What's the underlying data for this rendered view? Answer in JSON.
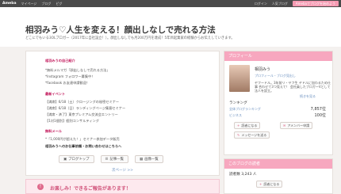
{
  "topbar": {
    "logo": "Ameba",
    "links": [
      "マイページ",
      "ブログ",
      "ピグ"
    ],
    "right_links": [
      "ログイン",
      "人気ブログ"
    ],
    "cta": "Amebaでブログを始めよう"
  },
  "blog": {
    "title": "相羽みう♡人生を変える！顔出しなしで売れる方法",
    "description": "どこにでもいる3OLブロガー（2017年に自社設立！）。顔出しなしでも月200万円を達成！5年目起業家の経験からお伝えしていきます。"
  },
  "article": {
    "lines": [
      {
        "text": "相羽みうの自己紹介",
        "style": "head"
      },
      {
        "text": "*無料メルマガ「顔出しなしで売れる方法」",
        "style": "plain"
      },
      {
        "text": "*Instagram フォロワー募集中！",
        "style": "plain"
      },
      {
        "text": "*facebook お友達申請歓迎！",
        "style": "plain"
      },
      {
        "text": "最新イベント",
        "style": "head"
      },
      {
        "text": "【満席】6/18（土）クロージングの秘密セミナー",
        "style": "plain"
      },
      {
        "text": "【満席】6/18（日）ランディングページ集客セミナー",
        "style": "plain"
      },
      {
        "text": "【満席・済了】東京プレミアム交流会エントリー",
        "style": "plain"
      },
      {
        "text": "【1対1個別】個別コンサルティング",
        "style": "plain"
      },
      {
        "text": "無料メール",
        "style": "head"
      },
      {
        "text": "*「1,000円が超えた！」セミナー参加データ販売",
        "style": "plain"
      },
      {
        "text": "相羽みうへのお仕事依頼・お問い合わせはこちらへ",
        "style": "bold"
      }
    ],
    "actions": [
      {
        "icon": "blog-icon",
        "label": "ブログトップ"
      },
      {
        "icon": "list-icon",
        "label": "記事一覧"
      },
      {
        "icon": "image-icon",
        "label": "画像一覧"
      }
    ]
  },
  "pager": {
    "label": "次ページ >>"
  },
  "notice": {
    "icon": "!",
    "text": "お楽しみ！できるご報告があります！"
  },
  "sidebar": {
    "profile_title": "プロフィール",
    "name": "相羽みう",
    "subtitle": "プロフィール・ブログ見出し",
    "bio": "ヤフードル。3年前リ・ヤフ生 ヤドルに加わるため仕事 合わせて3つ見えて！ 会社員したブロガーVとして 法人を設立。",
    "more": "続きを見る",
    "ranking_label": "ランキング",
    "ranking": [
      {
        "label": "全体ブログランキング",
        "value": "7,857位"
      },
      {
        "label": "ビジネス",
        "value": "100位"
      }
    ],
    "buttons": [
      {
        "icon": "plus-icon",
        "label": "読者になる"
      },
      {
        "icon": "mail-icon",
        "label": "アメンバー申請"
      },
      {
        "icon": "message-icon",
        "label": "メッセージを送る"
      }
    ],
    "readers_title": "このブログの読者",
    "readers_count": "読者数 3,243 人",
    "readers_button": "読者になる"
  }
}
